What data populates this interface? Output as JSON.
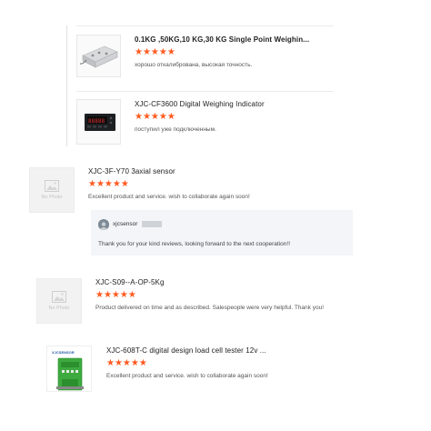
{
  "reviews": [
    {
      "product": "0.1KG ,50KG,10 KG,30 KG Single Point Weighin...",
      "stars": "★★★★★",
      "rating": 5,
      "comment": "хорошо откалибрована, высокая точность.",
      "image": "load-cell-photo"
    },
    {
      "product": "XJC-CF3600 Digital Weighing Indicator",
      "stars": "★★★★★",
      "rating": 5,
      "comment": "поступил уже подключенным.",
      "image": "weighing-indicator-photo"
    },
    {
      "product": "XJC-3F-Y70 3axial sensor",
      "stars": "★★★★★",
      "rating": 5,
      "comment": "Excellent product and service. wish to collaborate again soon!",
      "image": "no-photo",
      "placeholder": "No Photo"
    },
    {
      "product": "XJC-S09--A-OP-5Kg",
      "stars": "★★★★★",
      "rating": 5,
      "comment": "Product delivered on time and as described. Salespeople were very helpful. Thank you!",
      "image": "no-photo",
      "placeholder": "No Photo"
    },
    {
      "product": "XJC-608T-C digital design load cell tester 12v ...",
      "stars": "★★★★★",
      "rating": 5,
      "comment": "Excellent product and service. wish to collaborate again soon!",
      "image": "load-cell-tester-photo",
      "brand_label": "XJCSENSOR"
    }
  ],
  "reply": {
    "author": "xjcsensor",
    "text": "Thank you for your kind reviews, looking forward to the next cooperation!!"
  },
  "colors": {
    "star": "#ff5a1f",
    "reply_bg": "#f4f5f8",
    "divider": "#e2e2e2"
  }
}
